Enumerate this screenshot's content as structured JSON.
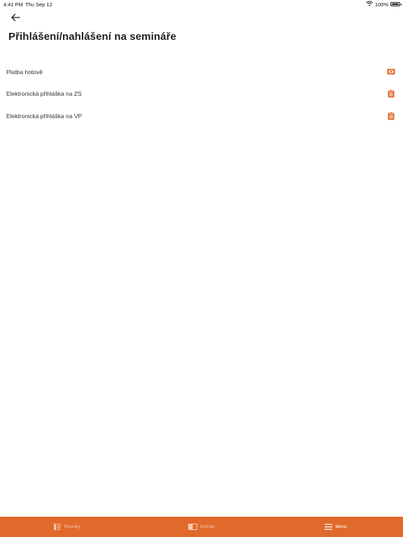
{
  "colors": {
    "accent": "#E06A2C",
    "tab_bar_bg": "#E06A2C",
    "tab_inactive": "#F6C9AE",
    "tab_active": "#FFFFFF",
    "text": "#333333"
  },
  "status_bar": {
    "time": "4:41 PM",
    "date": "Thu Sep 12",
    "wifi_icon": "wifi-icon",
    "battery_percent": "100%",
    "battery_level": 1.0
  },
  "header": {
    "back_icon": "arrow-left-icon",
    "title": "Přihlášení/nahlášení na semináře"
  },
  "list": {
    "items": [
      {
        "label": "Platba hotově",
        "icon": "eye-icon"
      },
      {
        "label": "Elektronická přihláška na ZS",
        "icon": "clipboard-icon"
      },
      {
        "label": "Elektronická přihláška na VP",
        "icon": "clipboard-icon"
      }
    ]
  },
  "tab_bar": {
    "tabs": [
      {
        "label": "Novinky",
        "icon": "news-list-icon",
        "active": false
      },
      {
        "label": "Instrukt",
        "icon": "book-icon",
        "active": false
      },
      {
        "label": "Menu",
        "icon": "hamburger-menu-icon",
        "active": true
      }
    ]
  }
}
